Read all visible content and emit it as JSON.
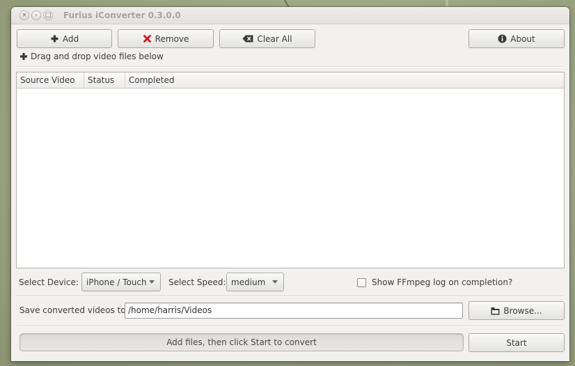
{
  "window": {
    "title": "Furius iConverter 0.3.0.0",
    "controls": {
      "close": "×",
      "minimize": "–",
      "maximize": "□"
    }
  },
  "toolbar": {
    "add_label": "Add",
    "remove_label": "Remove",
    "clear_all_label": "Clear All",
    "about_label": "About",
    "icons": {
      "add": "plus-icon",
      "remove": "red-x-icon",
      "clear_all": "backspace-icon",
      "about": "info-icon"
    },
    "colors": {
      "remove_icon": "#d01818",
      "icon_dark": "#3a3a3a"
    }
  },
  "hint": {
    "text": "Drag and drop video files below"
  },
  "table": {
    "columns": [
      "Source Video",
      "Status",
      "Completed"
    ],
    "rows": []
  },
  "settings": {
    "device_label": "Select Device:",
    "device_value": "iPhone / Touch",
    "speed_label": "Select Speed:",
    "speed_value": "medium",
    "ffmpeg_log_label": "Show FFmpeg log on completion?",
    "ffmpeg_log_checked": false
  },
  "output": {
    "label": "Save converted videos to:",
    "path": "/home/harris/Videos",
    "browse_label": "Browse..."
  },
  "status": {
    "progress_text": "Add files, then click Start to convert",
    "progress_fraction": 0,
    "start_label": "Start"
  }
}
